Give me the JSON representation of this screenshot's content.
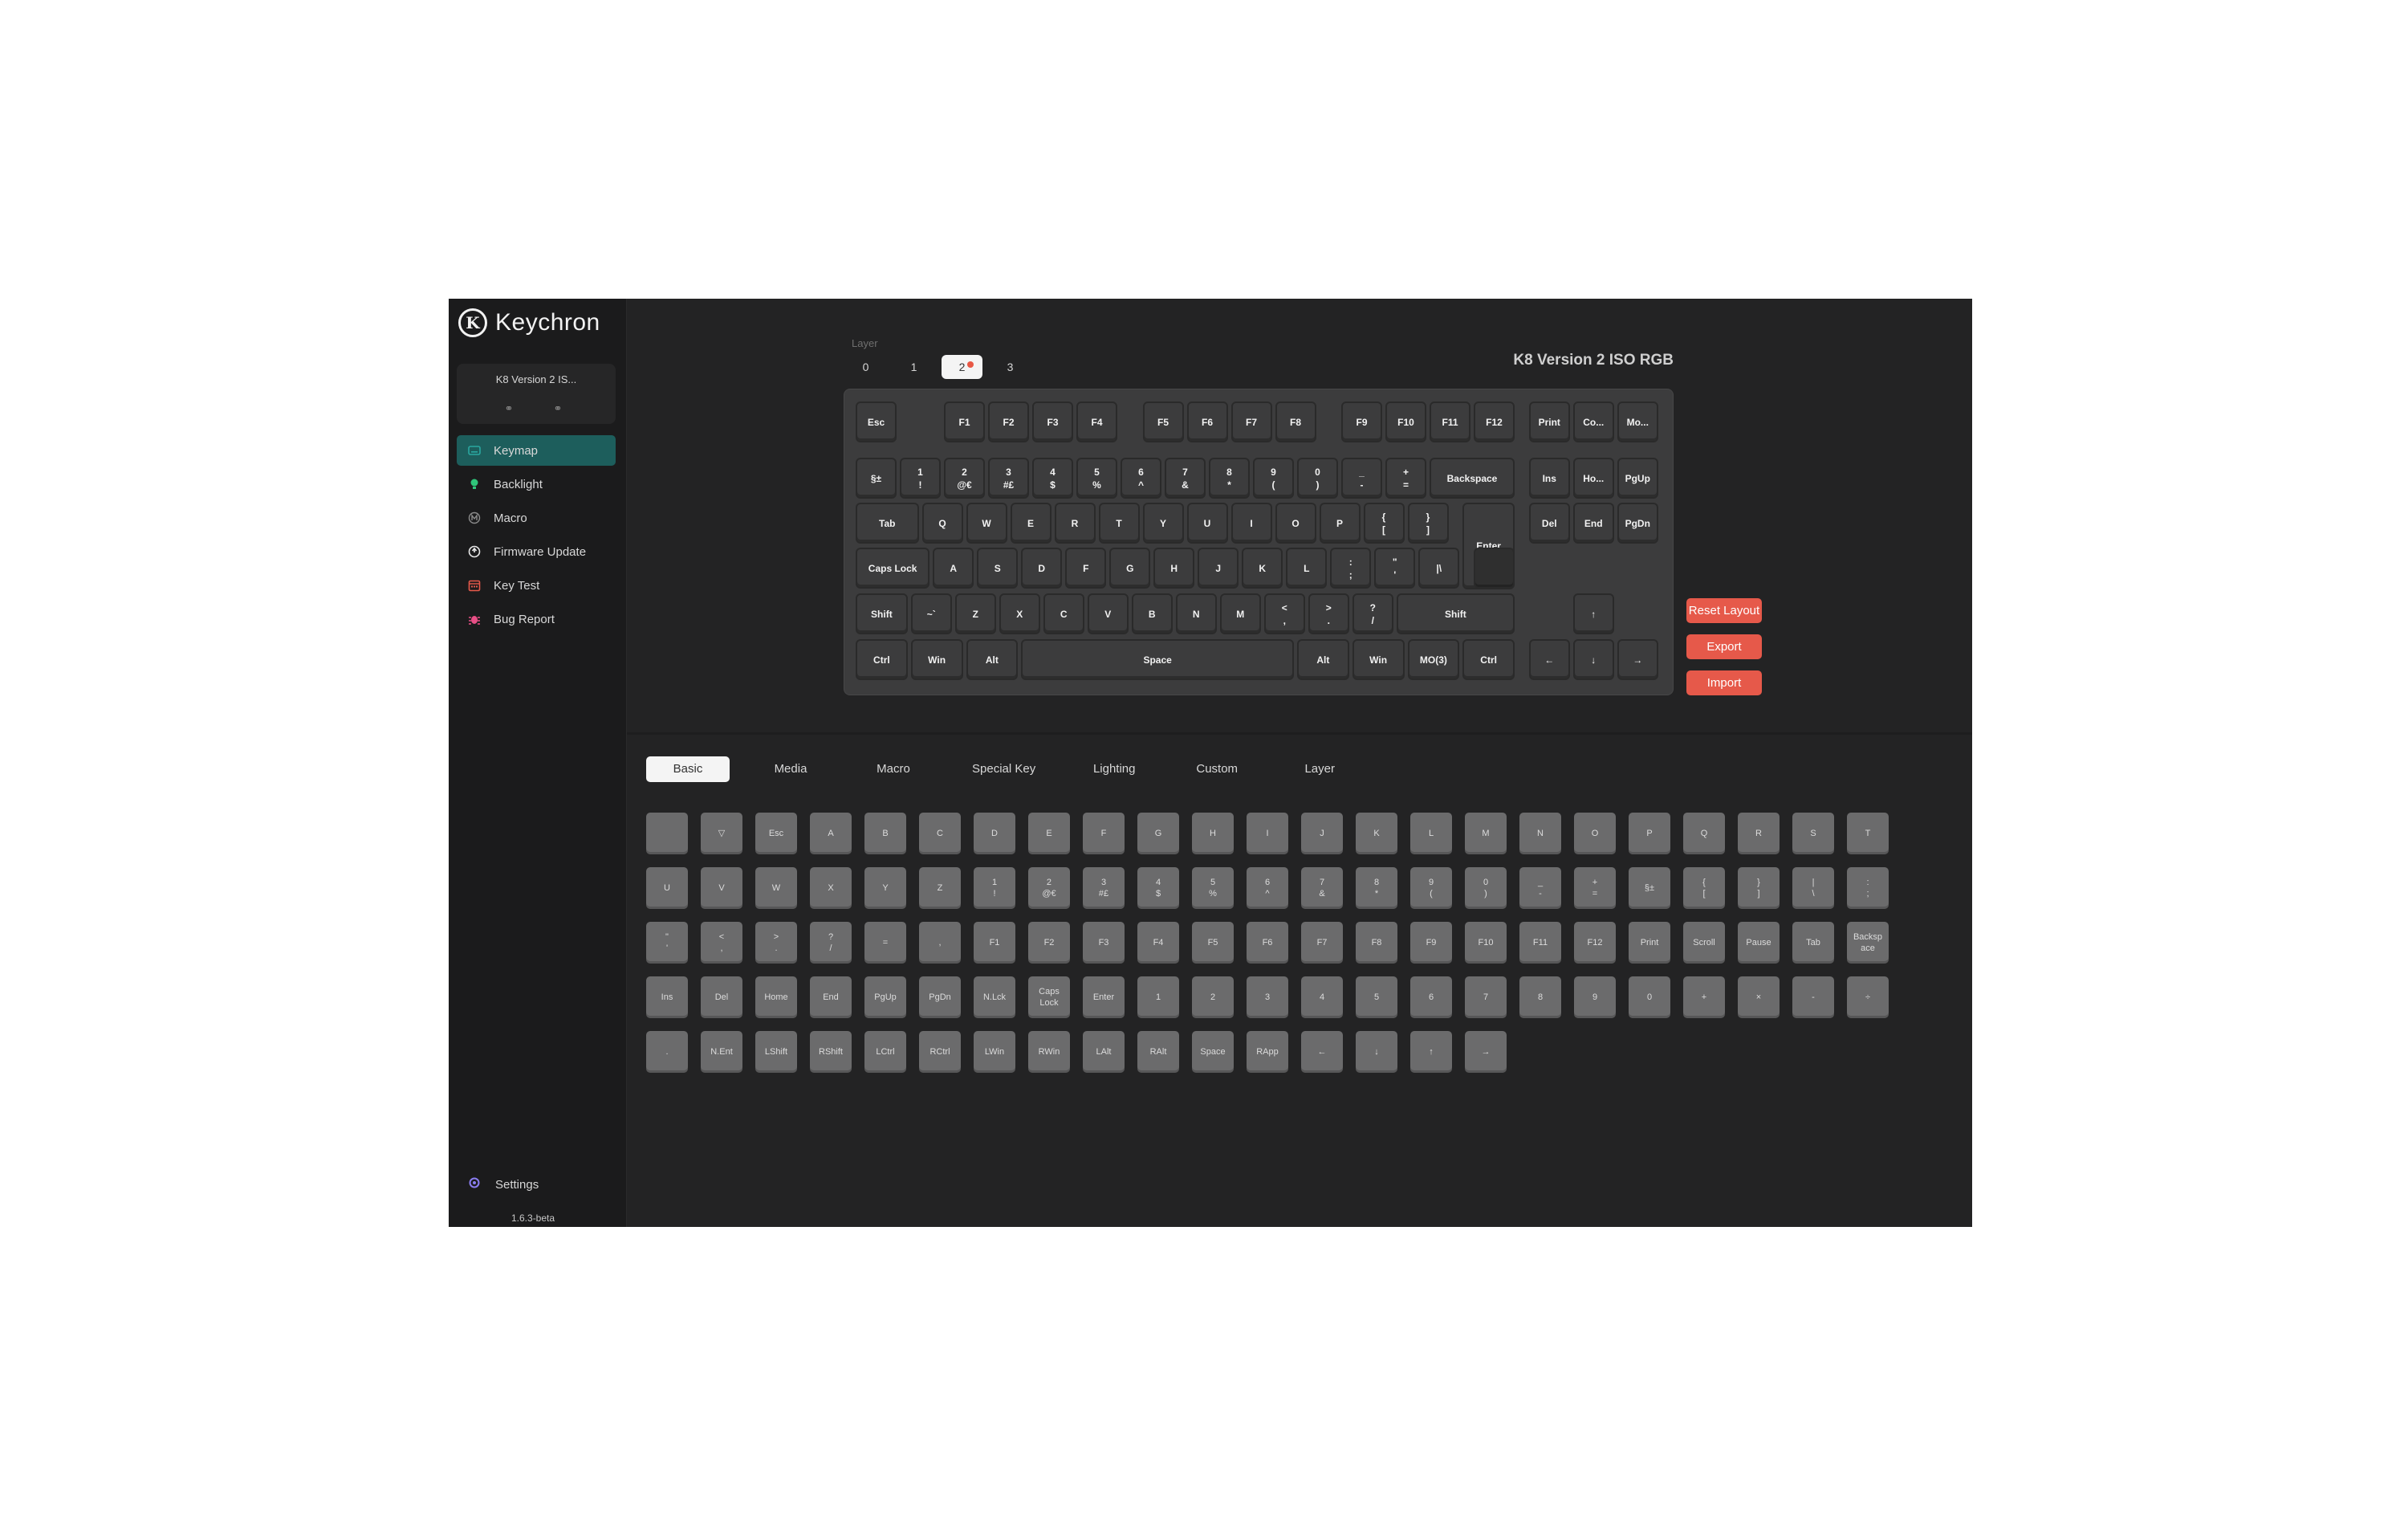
{
  "app": {
    "brand": "Keychron",
    "version": "1.6.3-beta"
  },
  "device": {
    "name": "K8 Version 2 IS...",
    "keyboard_name": "K8 Version 2 ISO RGB"
  },
  "sidebar": {
    "items": [
      {
        "label": "Keymap",
        "icon": "keyboard-icon",
        "color": "#2aa7a0",
        "active": true
      },
      {
        "label": "Backlight",
        "icon": "bulb-icon",
        "color": "#2fc67a"
      },
      {
        "label": "Macro",
        "icon": "macro-m-icon",
        "color": "#8c8c8c"
      },
      {
        "label": "Firmware Update",
        "icon": "firmware-update-icon",
        "color": "#e8e8e8"
      },
      {
        "label": "Key Test",
        "icon": "calendar-icon",
        "color": "#e6594a"
      },
      {
        "label": "Bug Report",
        "icon": "bug-icon",
        "color": "#e94f86"
      }
    ],
    "settings": {
      "label": "Settings",
      "icon": "gear-icon",
      "color": "#8a7df0"
    }
  },
  "layers": {
    "label": "Layer",
    "tabs": [
      "0",
      "1",
      "2",
      "3"
    ],
    "active_index": 2
  },
  "keyboard_keys": [
    "Esc",
    "F1",
    "F2",
    "F3",
    "F4",
    "F5",
    "F6",
    "F7",
    "F8",
    "F9",
    "F10",
    "F11",
    "F12",
    "Print",
    "Co...",
    "Mo...",
    "§±",
    "1\n!",
    "2\n@€",
    "3\n#£",
    "4\n$",
    "5\n%",
    "6\n^",
    "7\n&",
    "8\n*",
    "9\n(",
    "0\n)",
    "_\n-",
    "+\n=",
    "Backspace",
    "Ins",
    "Ho...",
    "PgUp",
    "Tab",
    "Q",
    "W",
    "E",
    "R",
    "T",
    "Y",
    "U",
    "I",
    "O",
    "P",
    "{\n[",
    "}\n]",
    "Enter",
    "Del",
    "End",
    "PgDn",
    "Caps Lock",
    "A",
    "S",
    "D",
    "F",
    "G",
    "H",
    "J",
    "K",
    "L",
    ":\n;",
    "\"\n'",
    "|\\",
    "",
    "Shift",
    "~`",
    "Z",
    "X",
    "C",
    "V",
    "B",
    "N",
    "M",
    "<\n,",
    ">\n.",
    "?\n/",
    "Shift",
    "↑",
    "Ctrl",
    "Win",
    "Alt",
    "Space",
    "Alt",
    "Win",
    "MO(3)",
    "Ctrl",
    "←",
    "↓",
    "→"
  ],
  "actions": {
    "reset": "Reset Layout",
    "export": "Export",
    "import": "Import"
  },
  "categories": [
    "Basic",
    "Media",
    "Macro",
    "Special Key",
    "Lighting",
    "Custom",
    "Layer"
  ],
  "active_category": 0,
  "basic_keys": [
    "",
    "▽",
    "Esc",
    "A",
    "B",
    "C",
    "D",
    "E",
    "F",
    "G",
    "H",
    "I",
    "J",
    "K",
    "L",
    "M",
    "N",
    "O",
    "P",
    "Q",
    "R",
    "S",
    "T",
    "U",
    "V",
    "W",
    "X",
    "Y",
    "Z",
    "1\n!",
    "2\n@€",
    "3\n#£",
    "4\n$",
    "5\n%",
    "6\n^",
    "7\n&",
    "8\n*",
    "9\n(",
    "0\n)",
    "_\n-",
    "+\n=",
    "§±",
    "{\n[",
    "}\n]",
    "|\n\\",
    ":\n;",
    "\"\n'",
    "<\n,",
    ">\n.",
    "?\n/",
    "=",
    ",",
    "F1",
    "F2",
    "F3",
    "F4",
    "F5",
    "F6",
    "F7",
    "F8",
    "F9",
    "F10",
    "F11",
    "F12",
    "Print",
    "Scroll",
    "Pause",
    "Tab",
    "Backsp\nace",
    "Ins",
    "Del",
    "Home",
    "End",
    "PgUp",
    "PgDn",
    "N.Lck",
    "Caps\nLock",
    "Enter",
    "1",
    "2",
    "3",
    "4",
    "5",
    "6",
    "7",
    "8",
    "9",
    "0",
    "+",
    "×",
    "-",
    "÷",
    ".",
    "N.Ent",
    "LShift",
    "RShift",
    "LCtrl",
    "RCtrl",
    "LWin",
    "RWin",
    "LAlt",
    "RAlt",
    "Space",
    "RApp",
    "←",
    "↓",
    "↑",
    "→"
  ]
}
